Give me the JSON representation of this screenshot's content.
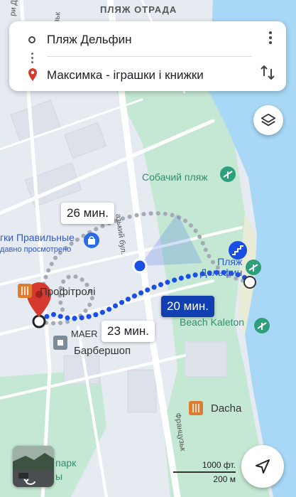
{
  "map": {
    "top_label": "ПЛЯЖ ОТРАДА",
    "places": {
      "dog_beach": "Собачий пляж",
      "toys_shop": "гки Правильные",
      "toys_shop_sub": "давно просмотрено",
      "beach_delfin": "Пляж\nДельфин",
      "profitroli": "Профітролі",
      "maer": "MAER",
      "barbershop": "Барбершоп",
      "beach_kaleton": "Beach Kaleton",
      "dacha": "Dacha",
      "park": "парк",
      "park2": "ы"
    },
    "streets": {
      "frantsuzskyi_upper": "Французьк",
      "frantsuzskyi_lower": "Французьк",
      "dovzhenka": "ри Довженка",
      "fonta_bul": "азький бул."
    }
  },
  "route_card": {
    "origin": "Пляж Дельфин",
    "destination": "Максимка - іграшки і книжки"
  },
  "routes": {
    "selected_time": "20 мин.",
    "alt1_time": "26 мин.",
    "alt2_time": "23 мин."
  },
  "scale": {
    "imperial": "1000 фт.",
    "metric": "200 м"
  },
  "colors": {
    "route": "#1a4fe6",
    "route_alt": "#a4abb4",
    "water": "#a8d8f5",
    "park": "#bfe6d0",
    "pin": "#d63a2f"
  },
  "icons": {
    "layers": "layers-icon",
    "navigate": "navigate-arrow-icon",
    "swap": "swap-vertical-icon",
    "more": "more-vertical-icon"
  }
}
